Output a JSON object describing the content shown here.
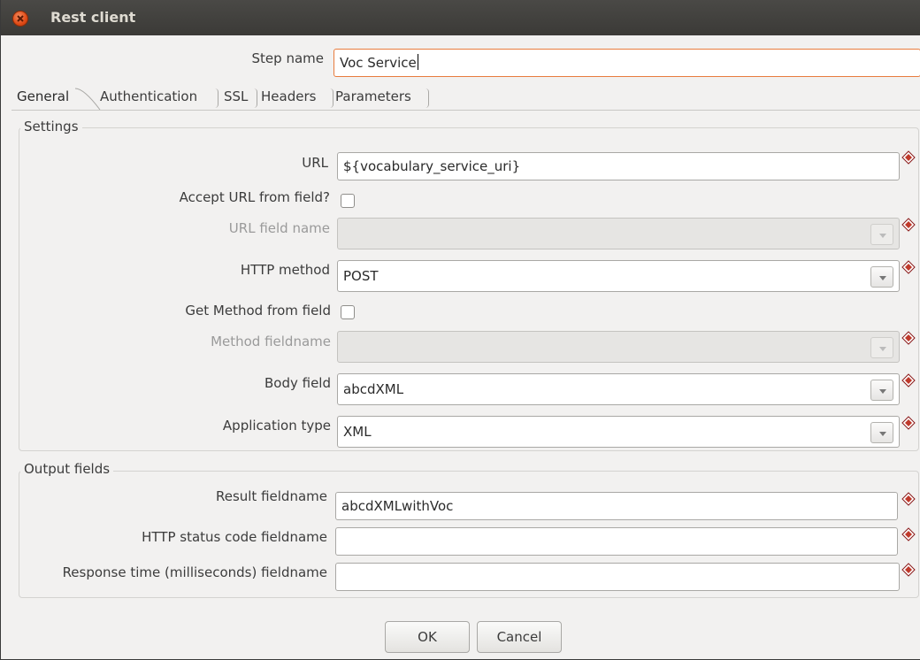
{
  "window": {
    "title": "Rest client"
  },
  "step": {
    "label": "Step name",
    "value": "Voc Service"
  },
  "tabs": [
    {
      "label": "General"
    },
    {
      "label": "Authentication"
    },
    {
      "label": "SSL"
    },
    {
      "label": "Headers"
    },
    {
      "label": "Parameters"
    }
  ],
  "settings": {
    "title": "Settings",
    "url": {
      "label": "URL",
      "value": "${vocabulary_service_uri}"
    },
    "accept_url": {
      "label": "Accept URL from field?"
    },
    "url_field": {
      "label": "URL field name",
      "value": ""
    },
    "http_method": {
      "label": "HTTP method",
      "value": "POST"
    },
    "get_method": {
      "label": "Get Method from field"
    },
    "method_field": {
      "label": "Method fieldname",
      "value": ""
    },
    "body_field": {
      "label": "Body field",
      "value": "abcdXML"
    },
    "app_type": {
      "label": "Application type",
      "value": "XML"
    }
  },
  "output": {
    "title": "Output fields",
    "result": {
      "label": "Result fieldname",
      "value": "abcdXMLwithVoc"
    },
    "status": {
      "label": "HTTP status code fieldname",
      "value": ""
    },
    "response": {
      "label": "Response time (milliseconds) fieldname",
      "value": ""
    }
  },
  "buttons": {
    "ok": "OK",
    "cancel": "Cancel"
  },
  "colors": {
    "titlebar": "#3c3b37",
    "focus": "#e87c3e",
    "close": "#df4a16",
    "variable_icon": "#c0392b"
  }
}
